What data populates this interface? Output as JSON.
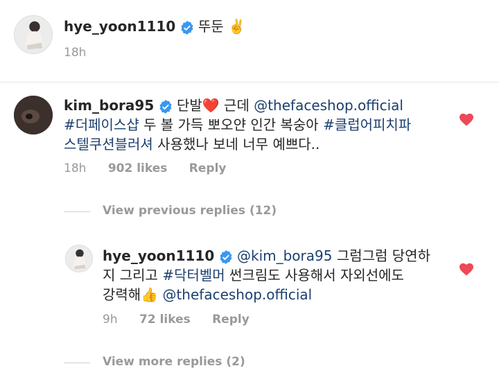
{
  "caption": {
    "username": "hye_yoon1110",
    "text": "뚜둔",
    "emoji": "✌️",
    "time": "18h"
  },
  "comment": {
    "username": "kim_bora95",
    "lines": [
      [
        {
          "t": "text",
          "v": "단발"
        },
        {
          "t": "emoji",
          "v": "❤️"
        },
        {
          "t": "text",
          "v": " 근데 "
        },
        {
          "t": "link",
          "v": "@thefaceshop.official"
        }
      ],
      [
        {
          "t": "link",
          "v": "#더페이스샵"
        },
        {
          "t": "text",
          "v": " 두 볼 가득 뽀오얀 인간 복숭아 "
        },
        {
          "t": "link",
          "v": "#클럽어피치파"
        }
      ],
      [
        {
          "t": "link",
          "v": "스텔쿠션블러셔"
        },
        {
          "t": "text",
          "v": " 사용했나 보네 너무 예쁘다.."
        }
      ]
    ],
    "time": "18h",
    "likes": "902 likes",
    "reply": "Reply",
    "liked_color": "#ed4956"
  },
  "view_previous": "View previous replies (12)",
  "reply_comment": {
    "username": "hye_yoon1110",
    "lines": [
      [
        {
          "t": "link",
          "v": "@kim_bora95"
        },
        {
          "t": "text",
          "v": " 그럼그럼 당연하"
        }
      ],
      [
        {
          "t": "text",
          "v": "지 그리고 "
        },
        {
          "t": "link",
          "v": "#닥터벨머"
        },
        {
          "t": "text",
          "v": " 썬크림도 사용해서 자외선에도"
        }
      ],
      [
        {
          "t": "text",
          "v": "강력해"
        },
        {
          "t": "emoji",
          "v": "👍"
        },
        {
          "t": "text",
          "v": " "
        },
        {
          "t": "link",
          "v": "@thefaceshop.official"
        }
      ]
    ],
    "time": "9h",
    "likes": "72 likes",
    "reply": "Reply",
    "liked_color": "#ed4956"
  },
  "view_more": "View more replies (2)",
  "colors": {
    "link": "#1c3f6e",
    "verified": "#3897f0",
    "heart": "#ed4956",
    "meta": "#999999"
  }
}
